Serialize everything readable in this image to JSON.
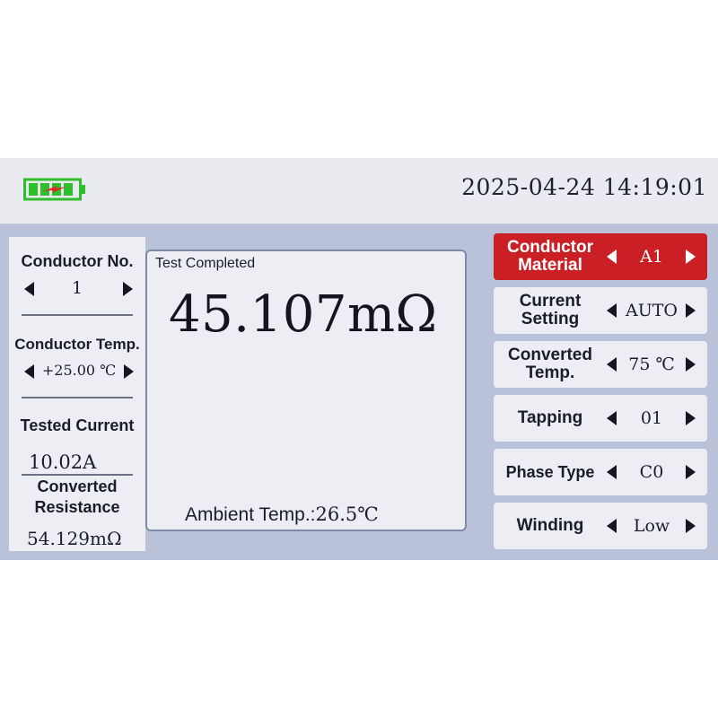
{
  "header": {
    "datetime": "2025-04-24 14:19:01",
    "battery_icon": "battery-charging-icon",
    "battery_color": "#2fbf2a",
    "charge_color": "#e0242a"
  },
  "left": {
    "conductor_no": {
      "label": "Conductor No.",
      "value": "1"
    },
    "conductor_temp": {
      "label": "Conductor Temp.",
      "value": "+25.00 ℃"
    },
    "tested_current": {
      "label": "Tested Current",
      "value": "10.02A"
    },
    "converted_resistance": {
      "label": "Converted Resistance",
      "line1": "Converted",
      "line2": "Resistance",
      "value": "54.129mΩ"
    }
  },
  "center": {
    "status": "Test Completed",
    "reading": "45.107mΩ",
    "ambient_label": "Ambient Temp.:",
    "ambient_value": "26.5℃"
  },
  "settings": [
    {
      "label": "Conductor Material",
      "line1": "Conductor",
      "line2": "Material",
      "value": "A1",
      "active": true
    },
    {
      "label": "Current Setting",
      "line1": "Current",
      "line2": "Setting",
      "value": "AUTO",
      "active": false
    },
    {
      "label": "Converted Temp.",
      "line1": "Converted",
      "line2": "Temp.",
      "value": "75 ℃",
      "active": false
    },
    {
      "label": "Tapping",
      "line1": "Tapping",
      "line2": "",
      "value": "01",
      "active": false
    },
    {
      "label": "Phase Type",
      "line1": "Phase Type",
      "line2": "",
      "value": "C0",
      "active": false
    },
    {
      "label": "Winding",
      "line1": "Winding",
      "line2": "",
      "value": "Low",
      "active": false
    }
  ],
  "colors": {
    "screen_bg": "#b9c2d9",
    "panel_bg": "#eceef3",
    "active_bg": "#c91f25"
  }
}
